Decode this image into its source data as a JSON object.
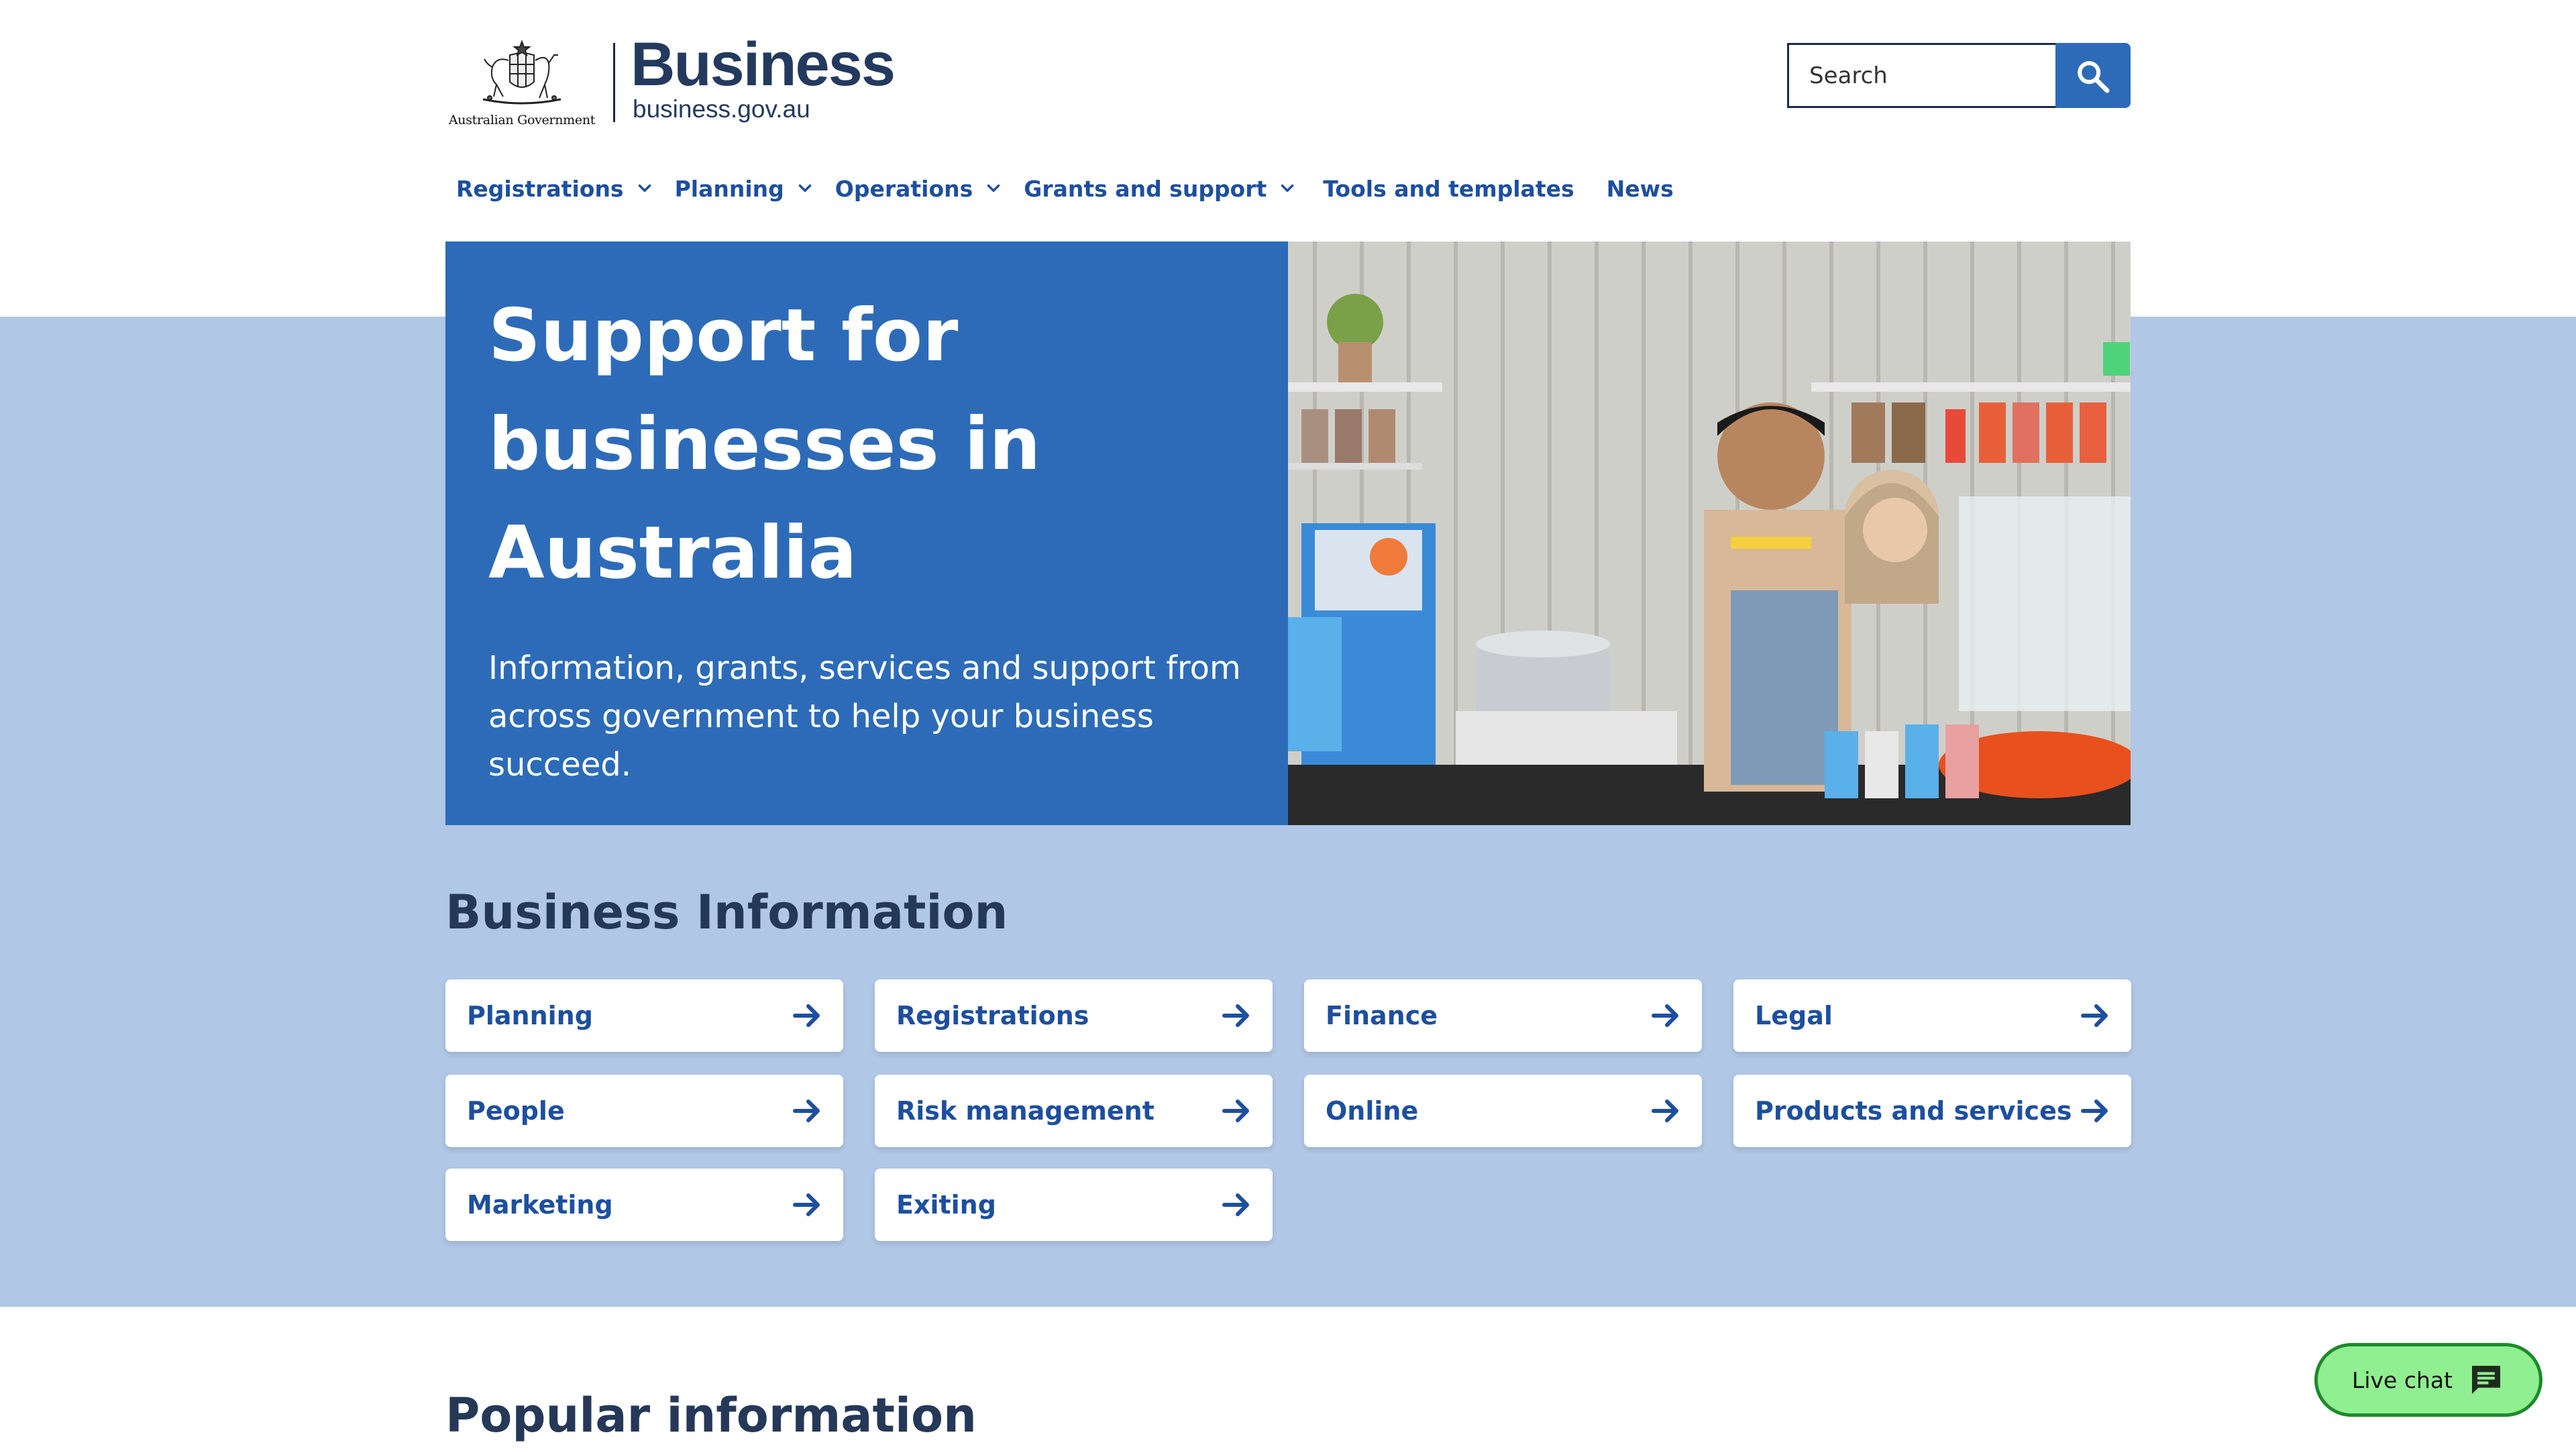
{
  "header": {
    "logo": {
      "government": "Australian Government",
      "brand": "Business",
      "url": "business.gov.au"
    },
    "search": {
      "placeholder": "Search"
    }
  },
  "nav": {
    "items": [
      {
        "label": "Registrations",
        "has_dropdown": true
      },
      {
        "label": "Planning",
        "has_dropdown": true
      },
      {
        "label": "Operations",
        "has_dropdown": true
      },
      {
        "label": "Grants and support",
        "has_dropdown": true
      },
      {
        "label": "Tools and templates",
        "has_dropdown": false
      },
      {
        "label": "News",
        "has_dropdown": false
      }
    ]
  },
  "hero": {
    "title": "Support for businesses in Australia",
    "subtitle": "Information, grants, services and support from across government to help your business succeed."
  },
  "business_info": {
    "title": "Business Information",
    "cards": [
      {
        "label": "Planning"
      },
      {
        "label": "Registrations"
      },
      {
        "label": "Finance"
      },
      {
        "label": "Legal"
      },
      {
        "label": "People"
      },
      {
        "label": "Risk management"
      },
      {
        "label": "Online"
      },
      {
        "label": "Products and services"
      },
      {
        "label": "Marketing"
      },
      {
        "label": "Exiting"
      }
    ]
  },
  "popular": {
    "title": "Popular information"
  },
  "live_chat": {
    "label": "Live chat"
  },
  "colors": {
    "primary_blue": "#2d6bb8",
    "link_blue": "#1d4fa0",
    "band_blue": "#b0c7e6",
    "heading": "#253858",
    "chat_green": "#90ef90"
  }
}
